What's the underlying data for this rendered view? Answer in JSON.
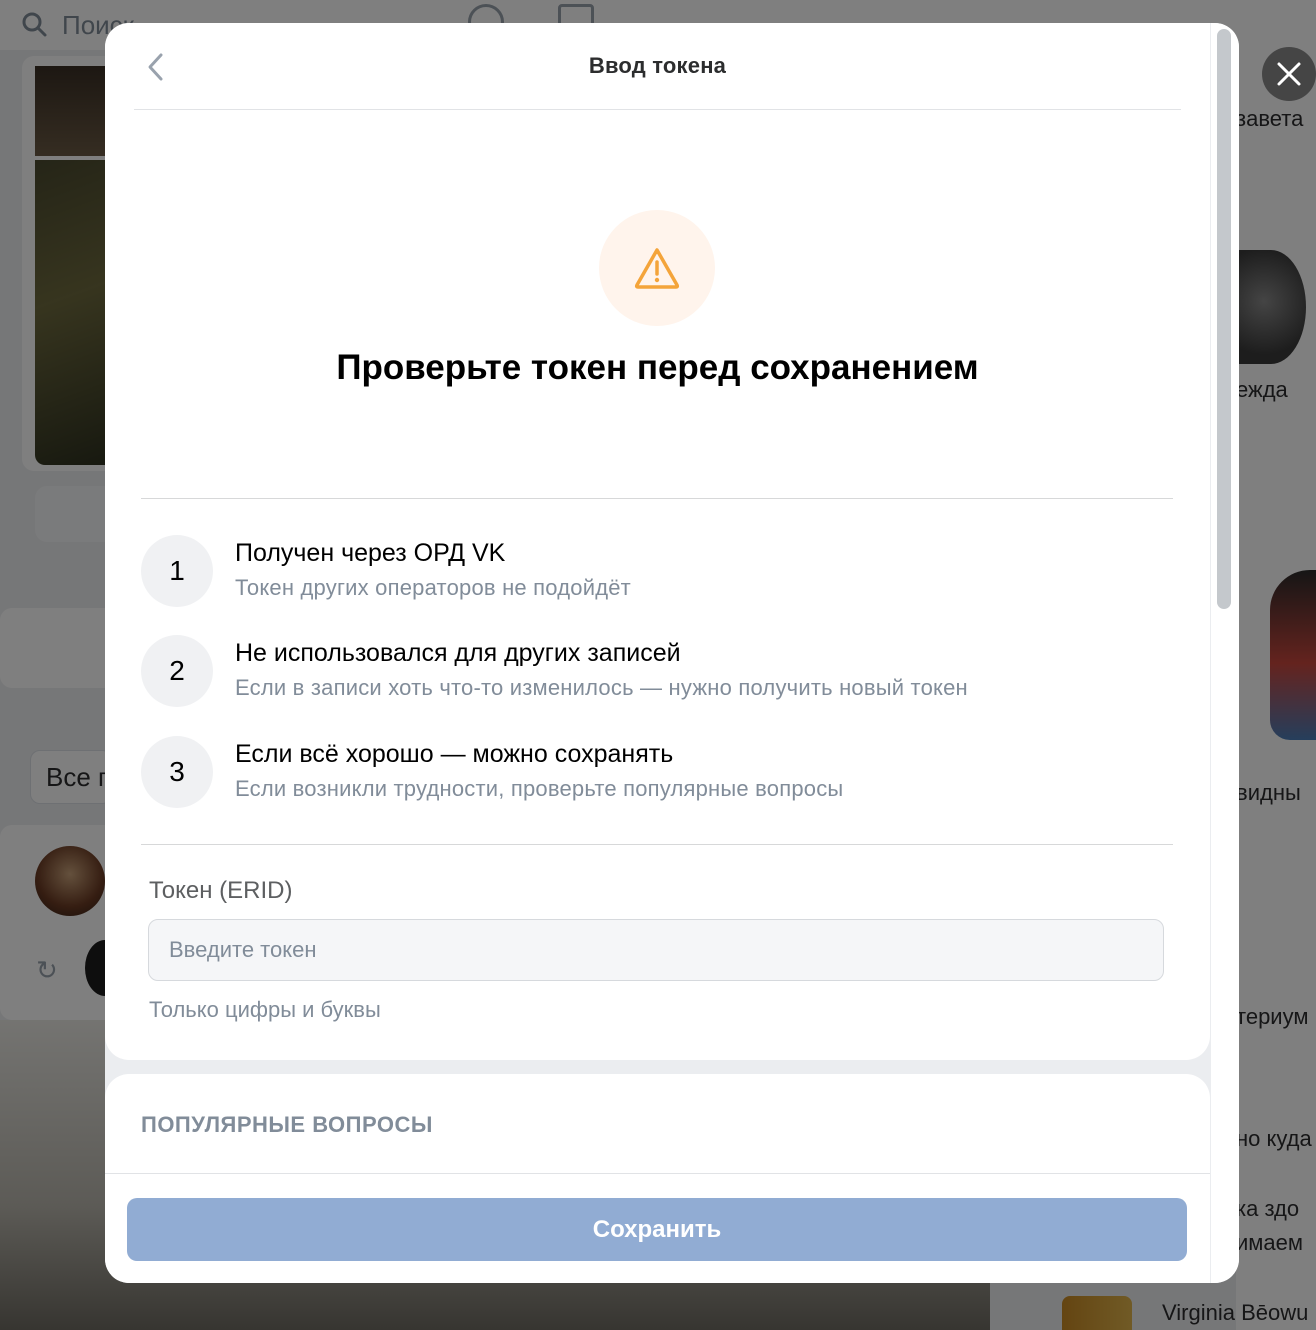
{
  "background": {
    "search_placeholder": "Поиск",
    "filter_pill": "Все п",
    "right_column": [
      "завета",
      "ежда",
      "видны",
      "териум",
      "но куда",
      "ка здо",
      "имаем",
      "Virginia Bēowu"
    ]
  },
  "modal": {
    "title": "Ввод токена",
    "headline": "Проверьте токен перед сохранением",
    "steps": [
      {
        "num": "1",
        "title": "Получен через ОРД VK",
        "subtitle": "Токен других операторов не подойдёт"
      },
      {
        "num": "2",
        "title": "Не использовался для других записей",
        "subtitle": "Если в записи хоть что-то изменилось — нужно получить новый токен"
      },
      {
        "num": "3",
        "title": "Если всё хорошо — можно сохранять",
        "subtitle": "Если возникли трудности, проверьте популярные вопросы"
      }
    ],
    "token_field": {
      "label": "Токен (ERID)",
      "placeholder": "Введите токен",
      "value": "",
      "hint": "Только цифры и буквы"
    },
    "faq_title": "ПОПУЛЯРНЫЕ ВОПРОСЫ",
    "save_label": "Сохранить"
  },
  "colors": {
    "warning_accent": "#f4a43a",
    "warning_bg": "#fff4ec",
    "button_disabled": "#91acd3"
  },
  "icons": {
    "back": "chevron-left-icon",
    "close": "close-icon",
    "warning": "warning-triangle-icon",
    "search": "search-icon"
  }
}
